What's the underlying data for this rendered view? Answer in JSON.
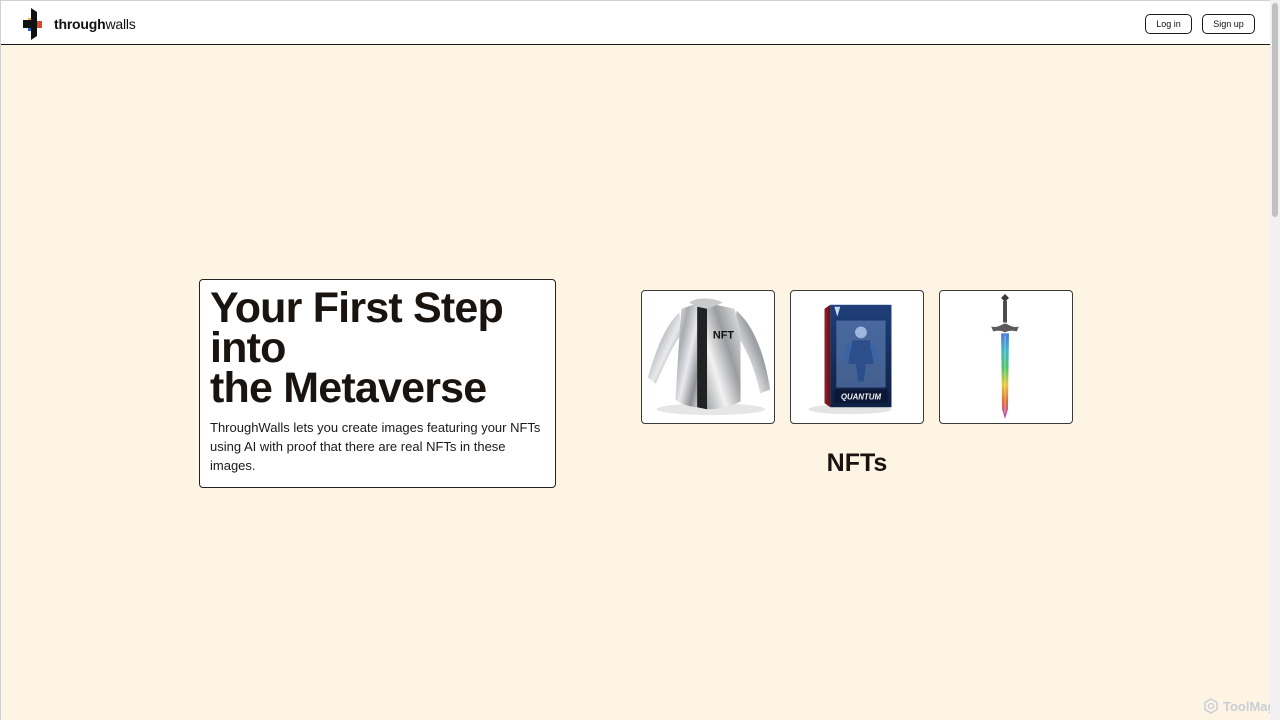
{
  "header": {
    "logo": {
      "icon": "throughwalls-logo-icon",
      "name_bold": "through",
      "name_light": "walls"
    },
    "login_label": "Log in",
    "signup_label": "Sign up"
  },
  "hero": {
    "title": "Your First Step\ninto\nthe Metaverse",
    "description": "ThroughWalls lets you create images featuring your NFTs using AI with proof that there are real NFTs in these images."
  },
  "nfts": {
    "heading": "NFTs",
    "items": [
      {
        "icon": "silver-jacket-image",
        "printed_text": "NFT"
      },
      {
        "icon": "action-figure-box-image",
        "printed_text": "QUANTUM"
      },
      {
        "icon": "rainbow-sword-image"
      }
    ]
  },
  "watermark": {
    "icon": "toolmage-logo-icon",
    "text": "ToolMage"
  },
  "colors": {
    "page_background": "#fdf4e4",
    "header_background": "#ffffff",
    "card_background": "#ffffff",
    "text": "#1a1410",
    "border": "#1b1b1b"
  }
}
